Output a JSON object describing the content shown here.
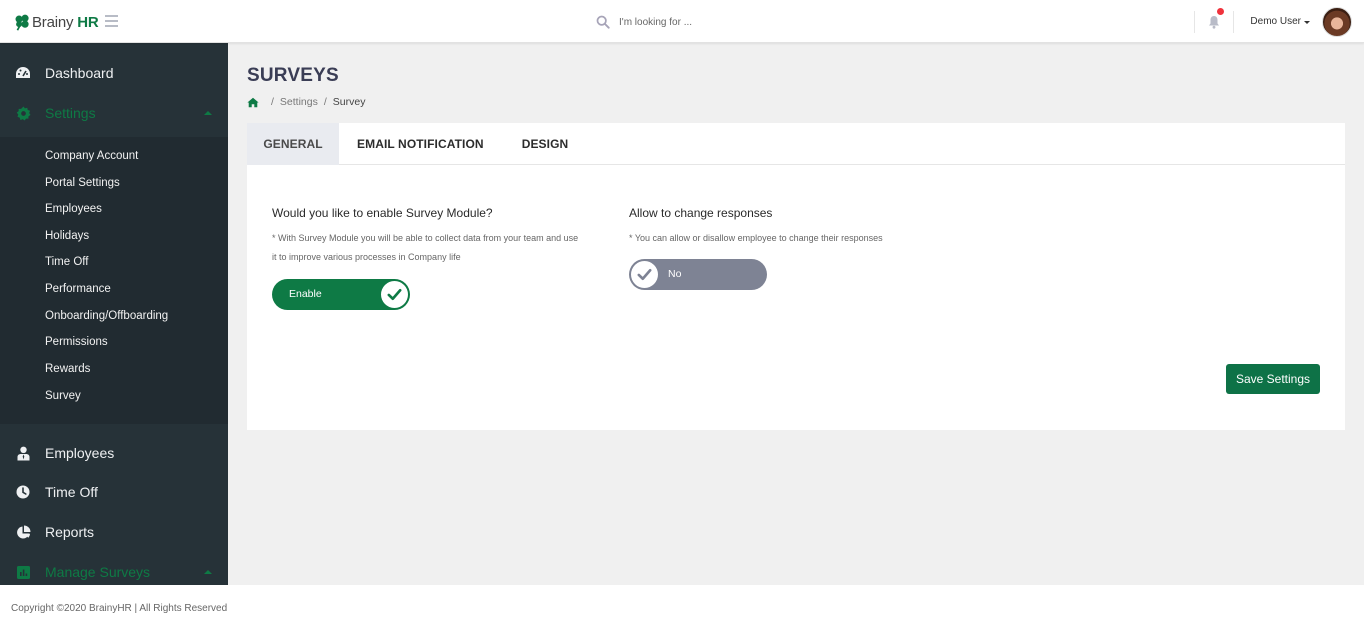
{
  "app": {
    "brand_prefix": "Brainy",
    "brand_suffix": "HR",
    "brand_color": "#0e7a45"
  },
  "topbar": {
    "search_placeholder": "I'm looking for ...",
    "user_name": "Demo User",
    "notification_badge": true
  },
  "sidebar": {
    "items": [
      {
        "label": "Dashboard",
        "icon": "dashboard-icon",
        "active": false
      },
      {
        "label": "Settings",
        "icon": "gear-icon",
        "active": true,
        "expanded": true
      },
      {
        "label": "Employees",
        "icon": "user-icon",
        "active": false
      },
      {
        "label": "Time Off",
        "icon": "clock-icon",
        "active": false
      },
      {
        "label": "Reports",
        "icon": "pie-chart-icon",
        "active": false
      },
      {
        "label": "Manage Surveys",
        "icon": "bar-chart-icon",
        "active": true,
        "expanded": true
      }
    ],
    "settings_submenu": [
      "Company Account",
      "Portal Settings",
      "Employees",
      "Holidays",
      "Time Off",
      "Performance",
      "Onboarding/Offboarding",
      "Permissions",
      "Rewards",
      "Survey"
    ]
  },
  "page": {
    "title": "SURVEYS",
    "breadcrumb": [
      "Settings",
      "Survey"
    ],
    "tabs": [
      {
        "label": "GENERAL",
        "active": true
      },
      {
        "label": "EMAIL NOTIFICATION",
        "active": false
      },
      {
        "label": "DESIGN",
        "active": false
      }
    ],
    "enable_module": {
      "title": "Would you like to enable Survey Module?",
      "help_line1": "* With Survey Module you will be able to collect data from your team and use",
      "help_line2": "it to improve various processes in Company life",
      "toggle_label": "Enable",
      "toggle_on": true
    },
    "allow_change": {
      "title": "Allow to change responses",
      "help": "* You can allow or disallow employee to change their responses",
      "toggle_label": "No",
      "toggle_on": false
    },
    "save_label": "Save Settings"
  },
  "footer": {
    "copyright": "Copyright ©2020 BrainyHR | All Rights Reserved"
  }
}
